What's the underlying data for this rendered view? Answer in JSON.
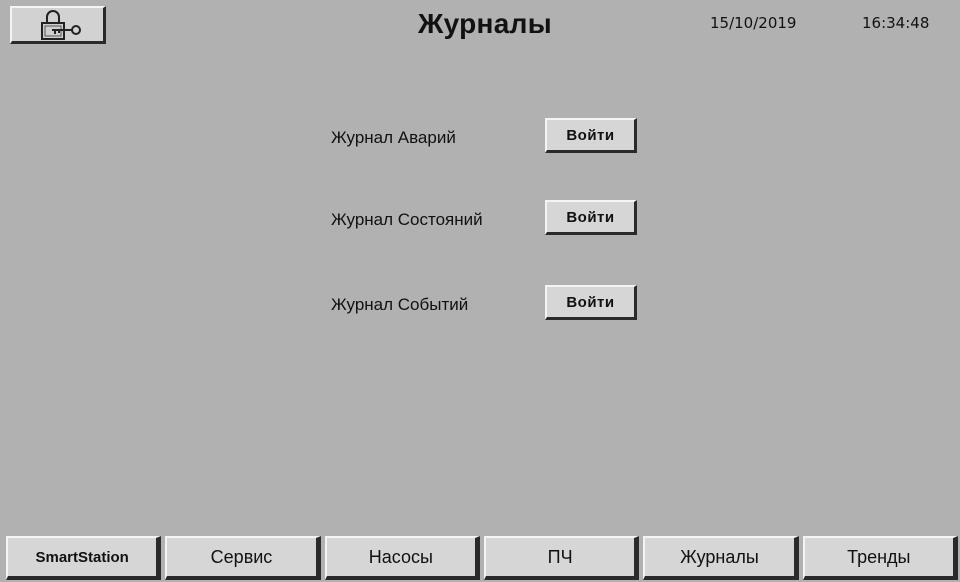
{
  "header": {
    "title": "Журналы",
    "date": "15/10/2019",
    "time": "16:34:48",
    "lock_icon": "lock-key-icon"
  },
  "logs": [
    {
      "label": "Журнал Аварий",
      "button": "Войти"
    },
    {
      "label": "Журнал Состояний",
      "button": "Войти"
    },
    {
      "label": "Журнал Событий",
      "button": "Войти"
    }
  ],
  "nav": [
    {
      "label": "SmartStation"
    },
    {
      "label": "Сервис"
    },
    {
      "label": "Насосы"
    },
    {
      "label": "ПЧ"
    },
    {
      "label": "Журналы"
    },
    {
      "label": "Тренды"
    }
  ],
  "colors": {
    "background": "#b1b1b1",
    "button_face": "#d6d6d6"
  }
}
